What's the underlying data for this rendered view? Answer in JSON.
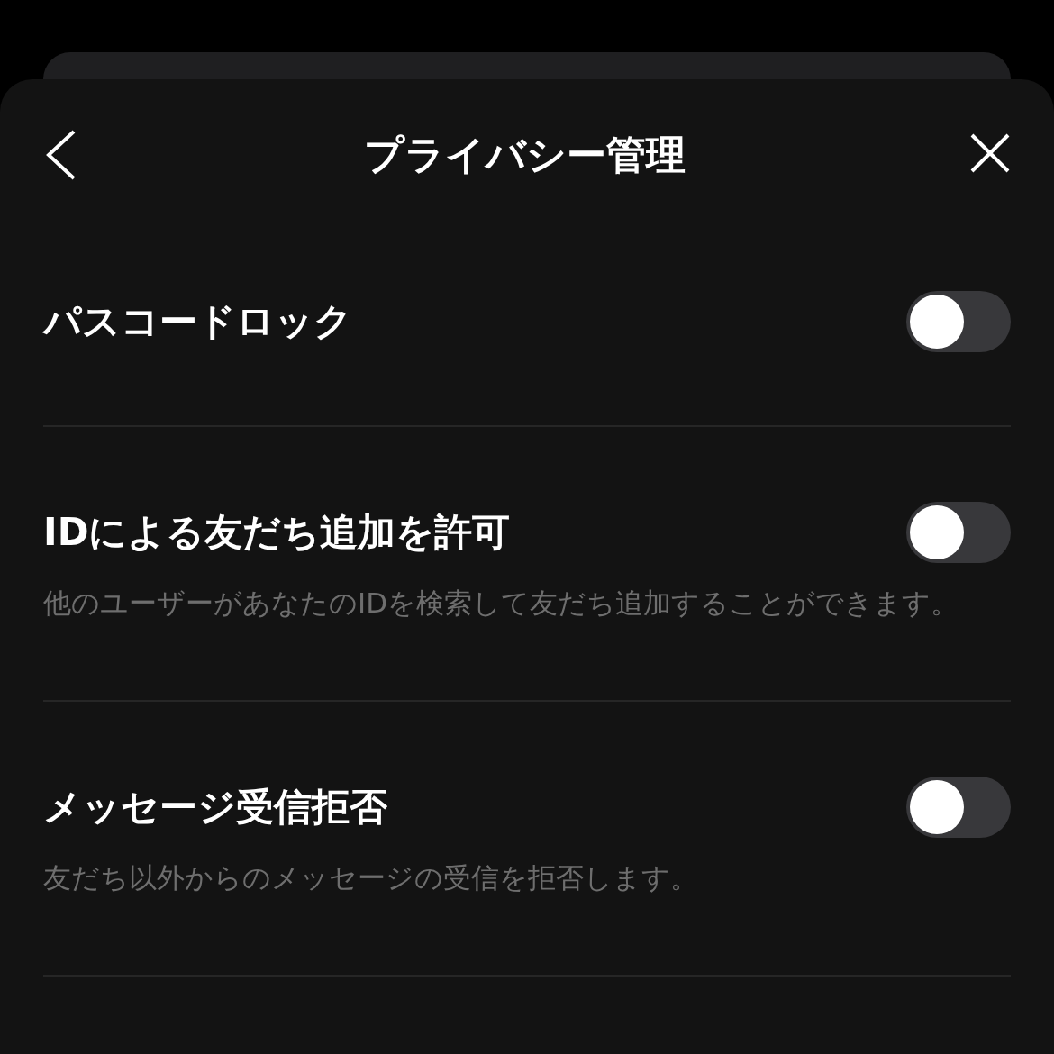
{
  "header": {
    "title": "プライバシー管理"
  },
  "settings": [
    {
      "label": "パスコードロック",
      "on": false
    },
    {
      "label": "IDによる友だち追加を許可",
      "on": false,
      "description": "他のユーザーがあなたのIDを検索して友だち追加することができます。"
    },
    {
      "label": "メッセージ受信拒否",
      "on": false,
      "description": "友だち以外からのメッセージの受信を拒否します。"
    }
  ]
}
